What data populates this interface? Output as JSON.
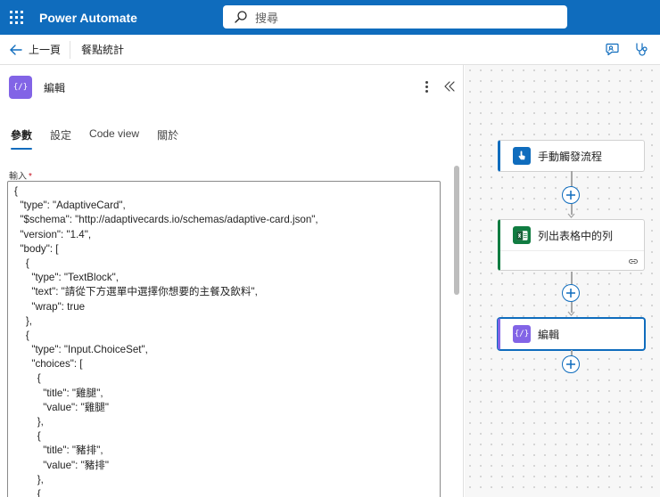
{
  "appbar": {
    "brand": "Power Automate",
    "search_placeholder": "搜尋"
  },
  "subbar": {
    "back_label": "上一頁",
    "flow_name": "餐點統計"
  },
  "panel": {
    "action_icon_text": "{/}",
    "title": "編輯",
    "tabs": [
      {
        "label": "參數",
        "active": true
      },
      {
        "label": "設定",
        "active": false
      },
      {
        "label": "Code view",
        "active": false
      },
      {
        "label": "關於",
        "active": false
      }
    ],
    "input_label": "輸入",
    "required_mark": "*",
    "code_lines": [
      "{",
      "  \"type\": \"AdaptiveCard\",",
      "  \"$schema\": \"http://adaptivecards.io/schemas/adaptive-card.json\",",
      "  \"version\": \"1.4\",",
      "  \"body\": [",
      "    {",
      "      \"type\": \"TextBlock\",",
      "      \"text\": \"請從下方選單中選擇你想要的主餐及飲料\",",
      "      \"wrap\": true",
      "    },",
      "    {",
      "      \"type\": \"Input.ChoiceSet\",",
      "      \"choices\": [",
      "        {",
      "          \"title\": \"雞腿\",",
      "          \"value\": \"雞腿\"",
      "        },",
      "        {",
      "          \"title\": \"豬排\",",
      "          \"value\": \"豬排\"",
      "        },",
      "        {"
    ]
  },
  "canvas": {
    "nodes": [
      {
        "label": "手動觸發流程",
        "icon": "hand-touch-icon",
        "color": "#0f6cbd"
      },
      {
        "label": "列出表格中的列",
        "icon": "excel-icon",
        "color": "#107c41"
      },
      {
        "label": "編輯",
        "icon_text": "{/}",
        "icon": "compose-icon",
        "color": "#8264e6"
      }
    ]
  },
  "colors": {
    "brand_blue": "#0f6cbd",
    "compose_purple": "#8264e6",
    "excel_green": "#107c41"
  }
}
